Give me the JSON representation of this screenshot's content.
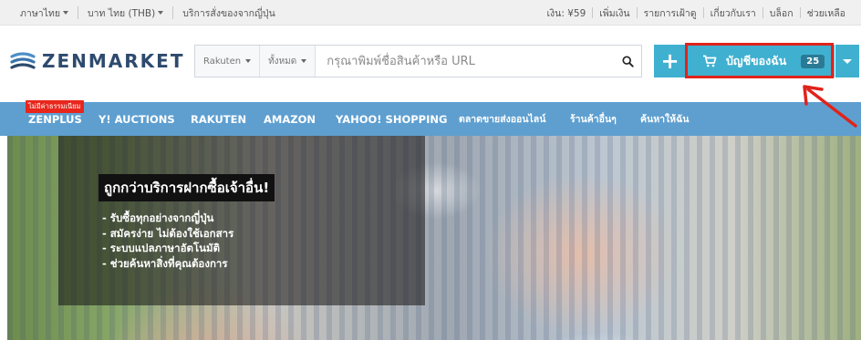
{
  "topbar": {
    "language": "ภาษาไทย",
    "currency": "บาท ไทย (THB)",
    "service": "บริการสั่งของจากญี่ปุ่น",
    "balance": "เงิน: ¥59",
    "links": [
      "เพิ่มเงิน",
      "รายการเฝ้าดู",
      "เกี่ยวกับเรา",
      "บล็อก",
      "ช่วยเหลือ"
    ]
  },
  "header": {
    "logo_text": "ZENMARKET",
    "search": {
      "shop_select": "Rakuten",
      "category_select": "ทั้งหมด",
      "placeholder": "กรุณาพิมพ์ชื่อสินค้าหรือ URL",
      "value": ""
    },
    "plus_label": "+",
    "cart_label": "บัญชีของฉัน",
    "cart_count": "25"
  },
  "nav": {
    "promo_badge": "ไม่มีค่าธรรมเนียม",
    "items": [
      "ZENPLUS",
      "Y! AUCTIONS",
      "RAKUTEN",
      "AMAZON",
      "YAHOO! SHOPPING",
      "ตลาดขายส่งออนไลน์",
      "ร้านค้าอื่นๆ",
      "ค้นหาให้ฉัน"
    ]
  },
  "hero": {
    "title": "ถูกกว่าบริการฝากซื้อเจ้าอื่น!",
    "bullets": [
      "รับซื้อทุกอย่างจากญี่ปุ่น",
      "สมัครง่าย ไม่ต้องใช้เอกสาร",
      "ระบบแปลภาษาอัตโนมัติ",
      "ช่วยค้นหาสิ่งที่คุณต้องการ"
    ]
  },
  "colors": {
    "accent": "#3fb0d0",
    "nav_bg": "#5e9fd0",
    "highlight": "#e0231b",
    "logo": "#2e4a6e"
  },
  "icons": {
    "search": "search-icon",
    "cart": "cart-icon",
    "logo": "zenmarket-logo-icon",
    "annotation": "arrow-annotation"
  }
}
